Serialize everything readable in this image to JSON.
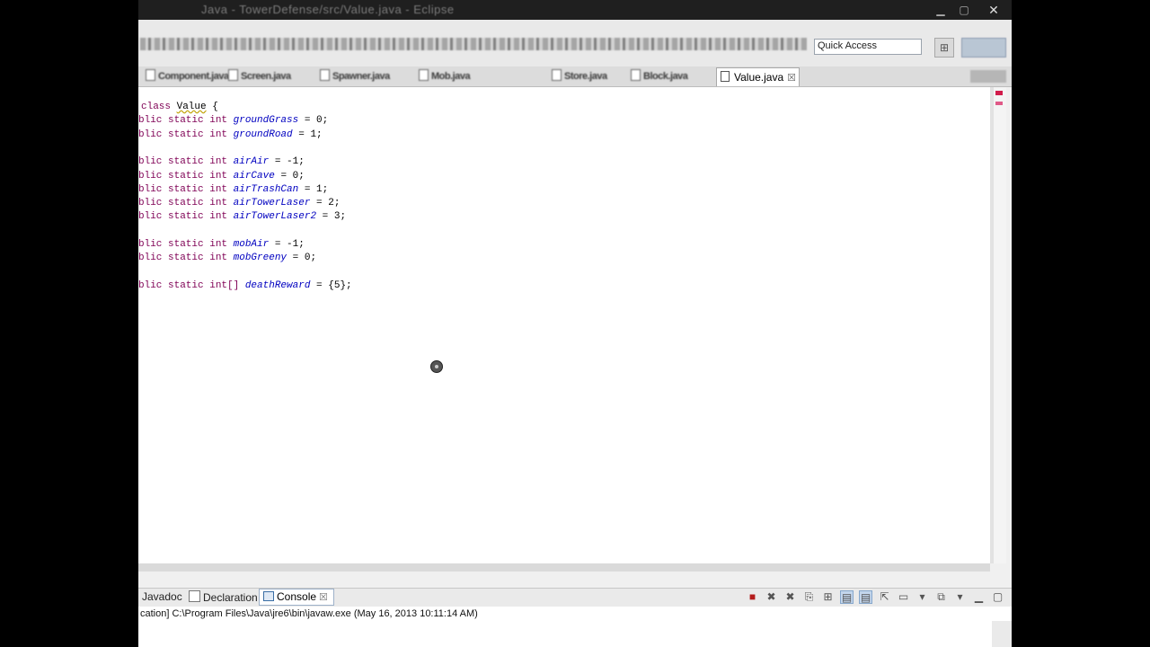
{
  "window": {
    "title": "Java - TowerDefense/src/Value.java - Eclipse",
    "close_glyph": "✕"
  },
  "toolbar": {
    "quick_access_placeholder": "Quick Access"
  },
  "editor_tabs": {
    "blurred": [
      "Component.java",
      "Screen.java",
      "Spawner.java",
      "Mob.java",
      "Store.java",
      "Block.java"
    ],
    "active": "Value.java",
    "active_close": "☒"
  },
  "code": {
    "lines": [
      {
        "t": "class",
        "parts": [
          [
            "kw",
            "class "
          ],
          [
            "u",
            "Value"
          ],
          [
            "p",
            " {"
          ]
        ]
      },
      {
        "parts": [
          [
            "kw",
            "blic static int "
          ],
          [
            "fld",
            "groundGrass"
          ],
          [
            "p",
            " = 0;"
          ]
        ]
      },
      {
        "parts": [
          [
            "kw",
            "blic static int "
          ],
          [
            "fld",
            "groundRoad"
          ],
          [
            "p",
            " = 1;"
          ]
        ]
      },
      {
        "parts": []
      },
      {
        "parts": [
          [
            "kw",
            "blic static int "
          ],
          [
            "fld",
            "airAir"
          ],
          [
            "p",
            " = -1;"
          ]
        ]
      },
      {
        "parts": [
          [
            "kw",
            "blic static int "
          ],
          [
            "fld",
            "airCave"
          ],
          [
            "p",
            " = 0;"
          ]
        ]
      },
      {
        "parts": [
          [
            "kw",
            "blic static int "
          ],
          [
            "fld",
            "airTrashCan"
          ],
          [
            "p",
            " = 1;"
          ]
        ]
      },
      {
        "parts": [
          [
            "kw",
            "blic static int "
          ],
          [
            "fld",
            "airTowerLaser"
          ],
          [
            "p",
            " = 2;"
          ]
        ]
      },
      {
        "parts": [
          [
            "kw",
            "blic static int "
          ],
          [
            "fld",
            "airTowerLaser2"
          ],
          [
            "p",
            " = 3;"
          ]
        ]
      },
      {
        "parts": []
      },
      {
        "parts": [
          [
            "kw",
            "blic static int "
          ],
          [
            "fld",
            "mobAir"
          ],
          [
            "p",
            " = -1;"
          ]
        ]
      },
      {
        "parts": [
          [
            "kw",
            "blic static int "
          ],
          [
            "fld",
            "mobGreeny"
          ],
          [
            "p",
            " = 0;"
          ]
        ]
      },
      {
        "parts": []
      },
      {
        "parts": [
          [
            "kw",
            "blic static int[] "
          ],
          [
            "fld",
            "deathReward"
          ],
          [
            "p",
            " = {5};"
          ]
        ]
      }
    ]
  },
  "bottom_panel": {
    "tabs": [
      "Javadoc",
      "Declaration"
    ],
    "active_tab": "Console",
    "active_close": "☒",
    "console_header": "cation] C:\\Program Files\\Java\\jre6\\bin\\javaw.exe (May 16, 2013 10:11:14 AM)"
  },
  "colors": {
    "keyword": "#7f0055",
    "field": "#0000c0"
  }
}
